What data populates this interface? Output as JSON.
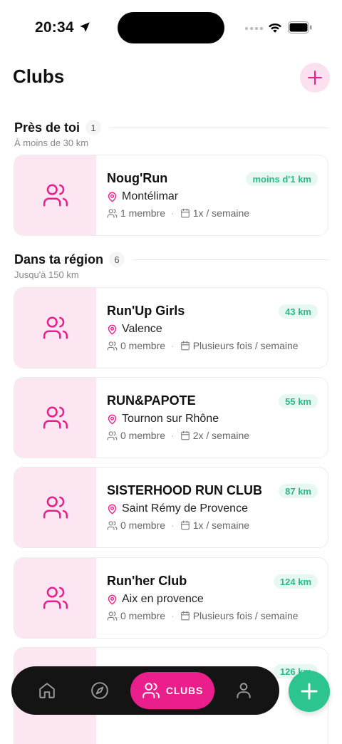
{
  "status_bar": {
    "time": "20:34"
  },
  "header": {
    "title": "Clubs"
  },
  "sections": [
    {
      "title": "Près de toi",
      "count": "1",
      "subtitle": "À moins de 30 km"
    },
    {
      "title": "Dans ta région",
      "count": "6",
      "subtitle": "Jusqu'à 150 km"
    }
  ],
  "clubs": [
    {
      "name": "Noug'Run",
      "distance": "moins d'1 km",
      "city": "Montélimar",
      "members": "1 membre",
      "frequency": "1x / semaine"
    },
    {
      "name": "Run'Up Girls",
      "distance": "43 km",
      "city": "Valence",
      "members": "0 membre",
      "frequency": "Plusieurs fois / semaine"
    },
    {
      "name": "RUN&PAPOTE",
      "distance": "55 km",
      "city": "Tournon sur Rhône",
      "members": "0 membre",
      "frequency": "2x / semaine"
    },
    {
      "name": "SISTERHOOD RUN CLUB",
      "distance": "87 km",
      "city": "Saint Rémy de Provence",
      "members": "0 membre",
      "frequency": "1x / semaine"
    },
    {
      "name": "Run'her Club",
      "distance": "124 km",
      "city": "Aix en provence",
      "members": "0 membre",
      "frequency": "Plusieurs fois / semaine"
    },
    {
      "name": "",
      "distance": "126 km",
      "city": "",
      "members": "",
      "frequency": ""
    }
  ],
  "bottom_nav": {
    "active_label": "CLUBS"
  },
  "colors": {
    "brand_pink": "#ea1f8c",
    "pink_bg": "#fce6f1",
    "green": "#2dc58f",
    "nav_bg": "#141414"
  },
  "icons": [
    "location-arrow-icon",
    "wifi-icon",
    "battery-icon",
    "plus-icon",
    "users-icon",
    "map-pin-icon",
    "calendar-icon",
    "home-icon",
    "compass-icon",
    "profile-icon"
  ]
}
